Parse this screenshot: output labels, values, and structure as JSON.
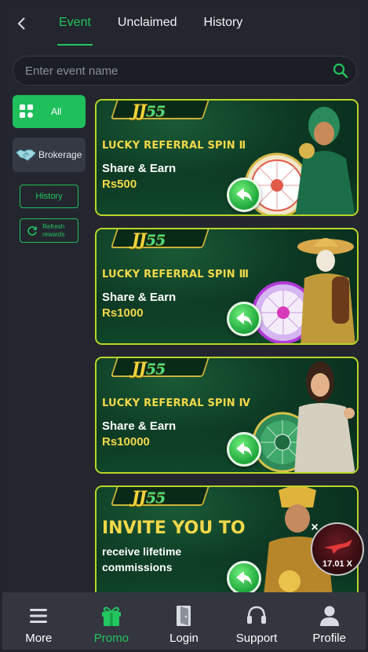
{
  "header": {
    "tabs": [
      {
        "label": "Event",
        "active": true
      },
      {
        "label": "Unclaimed",
        "active": false
      },
      {
        "label": "History",
        "active": false
      }
    ]
  },
  "search": {
    "placeholder": "Enter event name"
  },
  "sidebar": {
    "all_label": "All",
    "brokerage_label": "Brokerage",
    "history_label": "History",
    "refresh_label_line1": "Refresh",
    "refresh_label_line2": "rewards"
  },
  "banners": [
    {
      "logo_text": "JJ",
      "logo_num": "55",
      "title": "LUCKY REFERRAL SPIN Ⅱ",
      "subtitle": "Share & Earn",
      "amount": "Rs500"
    },
    {
      "logo_text": "JJ",
      "logo_num": "55",
      "title": "LUCKY REFERRAL SPIN Ⅲ",
      "subtitle": "Share & Earn",
      "amount": "Rs1000"
    },
    {
      "logo_text": "JJ",
      "logo_num": "55",
      "title": "LUCKY REFERRAL SPIN Ⅳ",
      "subtitle": "Share & Earn",
      "amount": "Rs10000"
    },
    {
      "logo_text": "JJ",
      "logo_num": "55",
      "title": "INVITE YOU TO",
      "subtitle_line1": "receive lifetime",
      "subtitle_line2": "commissions"
    }
  ],
  "floating_game": {
    "multiplier": "17.01 X",
    "close": "×"
  },
  "bottom_nav": [
    {
      "label": "More",
      "icon": "menu-icon",
      "active": false
    },
    {
      "label": "Promo",
      "icon": "gift-icon",
      "active": true
    },
    {
      "label": "Login",
      "icon": "door-icon",
      "active": false
    },
    {
      "label": "Support",
      "icon": "headset-icon",
      "active": false
    },
    {
      "label": "Profile",
      "icon": "user-icon",
      "active": false
    }
  ],
  "colors": {
    "accent": "#22c55e",
    "banner_border": "#b8d62a",
    "title_gold": "#f4d84a",
    "background": "#23262e"
  }
}
